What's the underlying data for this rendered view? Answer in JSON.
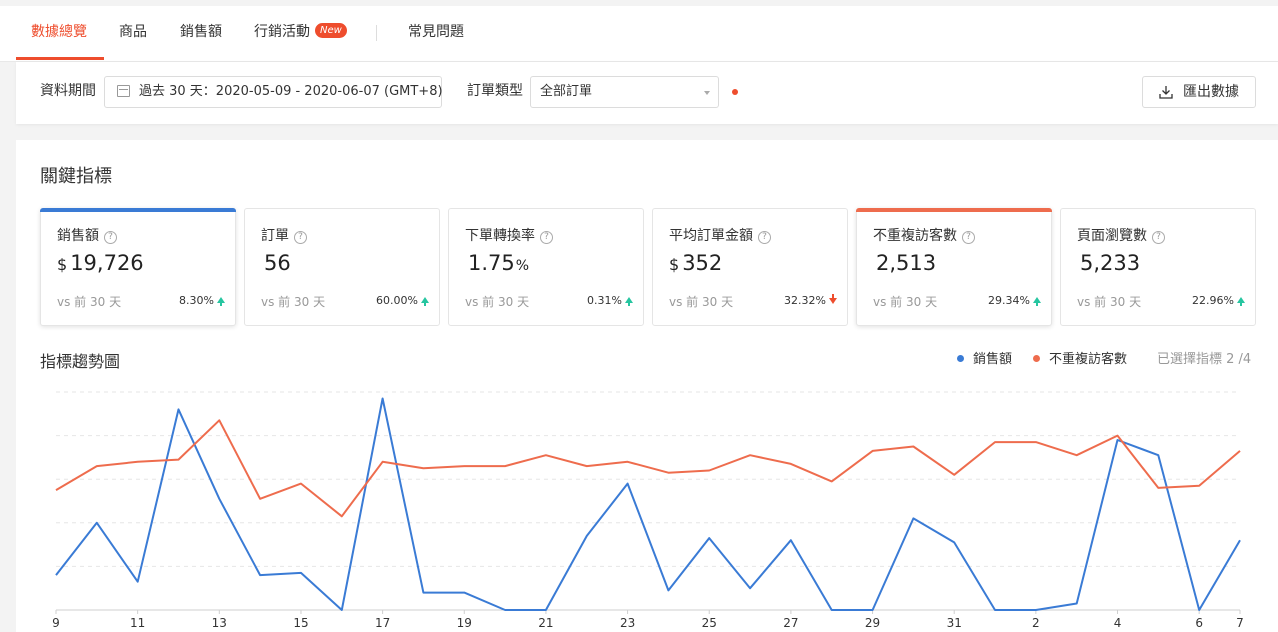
{
  "tabs": [
    {
      "label": "數據總覽",
      "active": true
    },
    {
      "label": "商品"
    },
    {
      "label": "銷售額"
    },
    {
      "label": "行銷活動",
      "badge": "New"
    },
    {
      "label": "常見問題"
    }
  ],
  "filters": {
    "period_label": "資料期間",
    "period_value": "過去 30 天：2020-05-09 - 2020-06-07 (GMT+8)",
    "order_type_label": "訂單類型",
    "order_type_value": "全部訂單",
    "export_label": "匯出數據"
  },
  "metrics_title": "關鍵指標",
  "metrics": [
    {
      "title": "銷售額",
      "currency": "$",
      "value": "19,726",
      "unit": "",
      "compare": "vs 前 30 天",
      "change": "8.30%",
      "direction": "up",
      "selected": true,
      "color": "#3a7bd5"
    },
    {
      "title": "訂單",
      "currency": "",
      "value": "56",
      "unit": "",
      "compare": "vs 前 30 天",
      "change": "60.00%",
      "direction": "up",
      "selected": false
    },
    {
      "title": "下單轉換率",
      "currency": "",
      "value": "1.75",
      "unit": "%",
      "compare": "vs 前 30 天",
      "change": "0.31%",
      "direction": "up",
      "selected": false
    },
    {
      "title": "平均訂單金額",
      "currency": "$",
      "value": "352",
      "unit": "",
      "compare": "vs 前 30 天",
      "change": "32.32%",
      "direction": "down",
      "selected": false
    },
    {
      "title": "不重複訪客數",
      "currency": "",
      "value": "2,513",
      "unit": "",
      "compare": "vs 前 30 天",
      "change": "29.34%",
      "direction": "up",
      "selected": true,
      "color": "#ee6c4d"
    },
    {
      "title": "頁面瀏覽數",
      "currency": "",
      "value": "5,233",
      "unit": "",
      "compare": "vs 前 30 天",
      "change": "22.96%",
      "direction": "up",
      "selected": false
    }
  ],
  "trend": {
    "title": "指標趨勢圖",
    "selected_count": "已選擇指標 2 /4"
  },
  "chart_data": {
    "type": "line",
    "x": [
      "9",
      "10",
      "11",
      "12",
      "13",
      "14",
      "15",
      "16",
      "17",
      "18",
      "19",
      "20",
      "21",
      "22",
      "23",
      "24",
      "25",
      "26",
      "27",
      "28",
      "29",
      "30",
      "31",
      "1",
      "2",
      "3",
      "4",
      "5",
      "6",
      "7"
    ],
    "tick_labels": [
      "9",
      "11",
      "13",
      "15",
      "17",
      "19",
      "21",
      "23",
      "25",
      "27",
      "29",
      "31",
      "2",
      "4",
      "6",
      "7"
    ],
    "tick_indices": [
      0,
      2,
      4,
      6,
      8,
      10,
      12,
      14,
      16,
      18,
      20,
      22,
      24,
      26,
      28,
      29
    ],
    "ylim": [
      0,
      100
    ],
    "grid": true,
    "legend_position": "top-right",
    "series": [
      {
        "name": "銷售額",
        "color": "#3a7bd5",
        "values": [
          16,
          40,
          13,
          92,
          51,
          16,
          17,
          0,
          97,
          8,
          8,
          0,
          0,
          34,
          58,
          9,
          33,
          10,
          32,
          0,
          0,
          42,
          31,
          0,
          0,
          3,
          78,
          71,
          0,
          32
        ]
      },
      {
        "name": "不重複訪客數",
        "color": "#ee6c4d",
        "values": [
          55,
          66,
          68,
          69,
          87,
          51,
          58,
          43,
          68,
          65,
          66,
          66,
          71,
          66,
          68,
          63,
          64,
          71,
          67,
          59,
          73,
          75,
          62,
          77,
          77,
          71,
          80,
          56,
          57,
          73
        ]
      }
    ]
  }
}
